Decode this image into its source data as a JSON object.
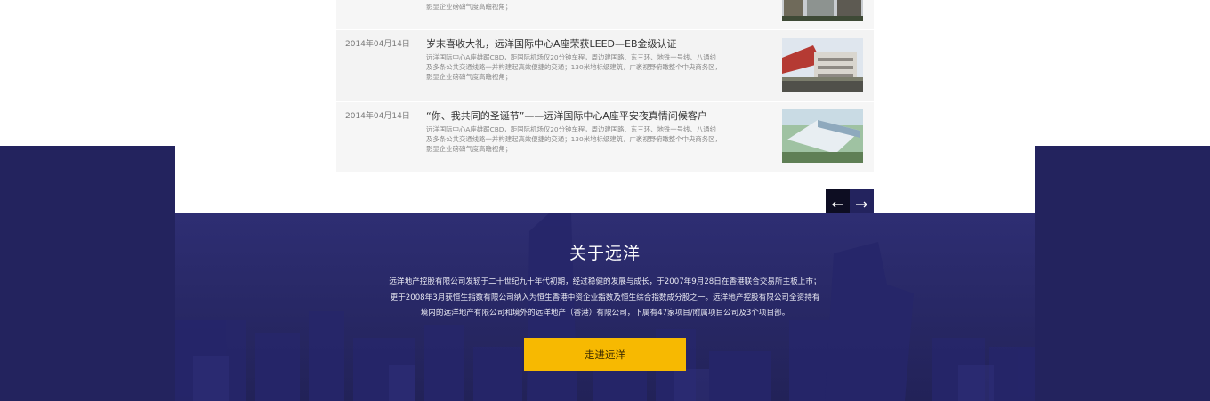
{
  "news": {
    "items": [
      {
        "date": "",
        "title": "",
        "desc": [
          "",
          "",
          "影显企业磅礴气度高瞻视角；"
        ]
      },
      {
        "date": "2014年04月14日",
        "title": "岁末喜收大礼，远洋国际中心A座荣获LEED—EB金级认证",
        "desc": [
          "远洋国际中心A座雄踞CBD，距国际机场仅20分钟车程，周边建国路、东三环、地铁一号线、八通线",
          "及多条公共交通线路一并构建起高效便捷的交通；130米地标级建筑，广袤视野俯瞰整个中央商务区，",
          "影显企业磅礴气度高瞻视角；"
        ]
      },
      {
        "date": "2014年04月14日",
        "title": "“你、我共同的圣诞节”——远洋国际中心A座平安夜真情问候客户",
        "desc": [
          "远洋国际中心A座雄踞CBD，距国际机场仅20分钟车程，周边建国路、东三环、地铁一号线、八通线",
          "及多条公共交通线路一并构建起高效便捷的交通；130米地标级建筑，广袤视野俯瞰整个中央商务区，",
          "影显企业磅礴气度高瞻视角；"
        ]
      }
    ]
  },
  "pager": {
    "prev_icon": "arrow-left-icon",
    "next_icon": "arrow-right-icon"
  },
  "about": {
    "title": "关于远洋",
    "lines": [
      "远洋地产控股有限公司发轫于二十世纪九十年代初期，经过稳健的发展与成长，于2007年9月28日在香港联合交易所主板上市；",
      "更于2008年3月获恒生指数有限公司纳入为恒生香港中资企业指数及恒生综合指数成分股之一。远洋地产控股有限公司全资持有",
      "境内的远洋地产有限公司和境外的远洋地产（香港）有限公司，下属有47家项目/附属项目公司及3个项目部。"
    ],
    "button_label": "走进远洋"
  },
  "colors": {
    "navy": "#23235e",
    "button_yellow": "#f7b901",
    "pager_dark": "#0d0d22"
  }
}
